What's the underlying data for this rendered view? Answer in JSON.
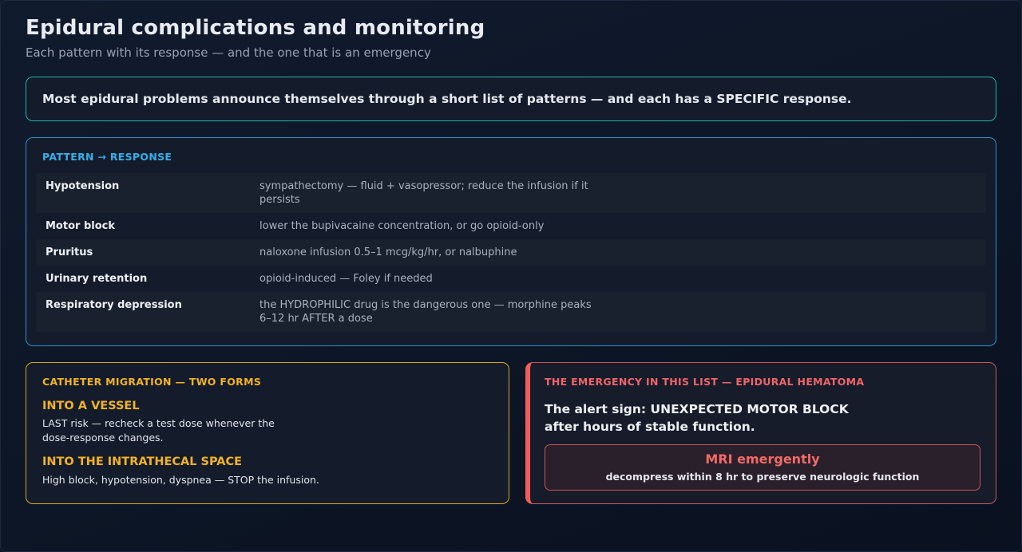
{
  "header": {
    "title": "Epidural complications and monitoring",
    "subtitle": "Each pattern with its response — and the one that is an emergency"
  },
  "callout": {
    "text": "Most epidural problems announce themselves through a short list of patterns — and each has a SPECIFIC response."
  },
  "patterns": {
    "label": "PATTERN → RESPONSE",
    "rows": [
      {
        "name": "Hypotension",
        "response": "sympathectomy — fluid + vasopressor; reduce the infusion if it persists"
      },
      {
        "name": "Motor block",
        "response": "lower the bupivacaine concentration, or go opioid-only"
      },
      {
        "name": "Pruritus",
        "response": "naloxone infusion 0.5–1 mcg/kg/hr, or nalbuphine"
      },
      {
        "name": "Urinary retention",
        "response": "opioid-induced — Foley if needed"
      },
      {
        "name": "Respiratory depression",
        "response": "the HYDROPHILIC drug is the dangerous one — morphine peaks 6–12 hr AFTER a dose"
      }
    ]
  },
  "migration": {
    "label": "CATHETER MIGRATION — TWO FORMS",
    "vessel_heading": "INTO A VESSEL",
    "vessel_text": "LAST risk — recheck a test dose whenever the dose-response changes.",
    "intrathecal_heading": "INTO THE INTRATHECAL SPACE",
    "intrathecal_text": "High block, hypotension, dyspnea — STOP the infusion."
  },
  "emergency": {
    "label": "THE EMERGENCY IN THIS LIST — EPIDURAL HEMATOMA",
    "alert": "The alert sign: UNEXPECTED MOTOR BLOCK after hours of stable function.",
    "action_title": "MRI emergently",
    "action_detail": "decompress within 8 hr to preserve neurologic function"
  },
  "colors": {
    "callout_border": "#22b3a6",
    "patterns_accent": "#35b0ea",
    "migration_accent": "#f2b325",
    "emergency_accent": "#f0646a"
  }
}
